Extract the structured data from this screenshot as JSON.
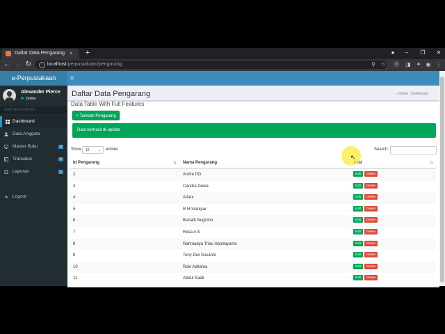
{
  "browser": {
    "tab_title": "Daftar Data Pengarang",
    "url_host": "localhost",
    "url_path": "/perpustakaan/pengarang"
  },
  "app": {
    "logo": "e-Perpustakaan",
    "user": {
      "name": "Alexander Pierce",
      "status": "Online"
    },
    "nav_header": "MAIN NAVIGATION",
    "menu": [
      {
        "label": "Dashboard",
        "active": true
      },
      {
        "label": "Data Anggota"
      },
      {
        "label": "Master Buku",
        "badge": "3"
      },
      {
        "label": "Transaksi",
        "badge": "2"
      },
      {
        "label": "Laporan",
        "badge": "1"
      },
      {
        "label": "Logout"
      }
    ]
  },
  "page": {
    "title": "Daftar Data Pengarang",
    "breadcrumb": {
      "home": "Home",
      "current": "Dashboard"
    },
    "box_title": "Data Table With Full Features",
    "add_button": "+ Tambah Pengarang",
    "alert": "Data berhasil di-update"
  },
  "table": {
    "show_label": "Show",
    "length_value": "10",
    "entries_label": "entries",
    "search_label": "Search:",
    "columns": [
      "Id Pengarang",
      "Nama Pengarang",
      "Aksi"
    ],
    "edit_label": "Edit",
    "delete_label": "Delete",
    "rows": [
      {
        "id": "2",
        "name": "Andre DD"
      },
      {
        "id": "3",
        "name": "Candra Dewa"
      },
      {
        "id": "4",
        "name": "Arlani"
      },
      {
        "id": "5",
        "name": "R H Sianipar"
      },
      {
        "id": "6",
        "name": "Bunafit Nugroho"
      },
      {
        "id": "7",
        "name": "Rosa A S"
      },
      {
        "id": "8",
        "name": "Rahmadya Trias Handayanto"
      },
      {
        "id": "9",
        "name": "Tony Dwi Susanto"
      },
      {
        "id": "10",
        "name": "Roki Aditama"
      },
      {
        "id": "11",
        "name": "Abdul Kadir"
      }
    ]
  },
  "colors": {
    "primary": "#3c8dbc",
    "sidebar": "#222d32",
    "success": "#00a65a",
    "danger": "#dd4b39"
  }
}
